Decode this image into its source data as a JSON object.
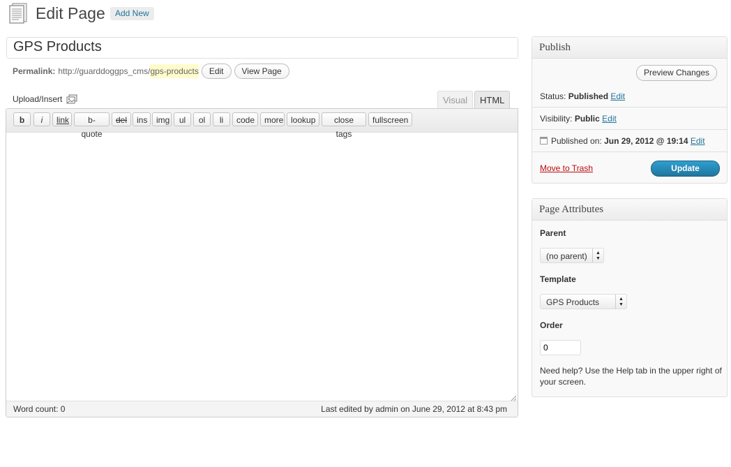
{
  "header": {
    "title": "Edit Page",
    "add_new": "Add New"
  },
  "post": {
    "title": "GPS Products",
    "permalink_label": "Permalink:",
    "permalink_base": "http://guarddoggps_cms/",
    "permalink_slug": "gps-products",
    "edit_label": "Edit",
    "view_label": "View Page"
  },
  "editor": {
    "upload_label": "Upload/Insert",
    "tabs": {
      "visual": "Visual",
      "html": "HTML"
    },
    "quicktags": [
      "b",
      "i",
      "link",
      "b-quote",
      "del",
      "ins",
      "img",
      "ul",
      "ol",
      "li",
      "code",
      "more",
      "lookup",
      "close tags",
      "fullscreen"
    ],
    "word_count": "Word count: 0",
    "last_edited": "Last edited by admin on June 29, 2012 at 8:43 pm"
  },
  "publish": {
    "title": "Publish",
    "preview": "Preview Changes",
    "status_label": "Status:",
    "status_value": "Published",
    "visibility_label": "Visibility:",
    "visibility_value": "Public",
    "published_label": "Published on:",
    "published_value": "Jun 29, 2012 @ 19:14",
    "edit": "Edit",
    "trash": "Move to Trash",
    "update": "Update"
  },
  "attributes": {
    "title": "Page Attributes",
    "parent_label": "Parent",
    "parent_value": "(no parent)",
    "template_label": "Template",
    "template_value": "GPS Products",
    "order_label": "Order",
    "order_value": "0",
    "help": "Need help? Use the Help tab in the upper right of your screen."
  },
  "colors": {
    "link": "#21759b",
    "trash": "#bc0b0b",
    "update_button": "#21759b",
    "slug_highlight": "#fffbcc"
  },
  "icons": {
    "page": "page-icon",
    "media": "upload-media-icon",
    "calendar": "calendar-icon"
  }
}
